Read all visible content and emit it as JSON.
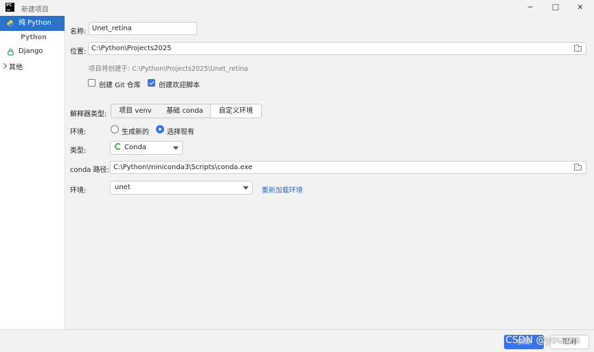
{
  "window": {
    "title": "新建项目",
    "logo_text_top": "PC",
    "minimize": "─",
    "maximize": "☐",
    "close": "✕"
  },
  "sidebar": {
    "items": [
      {
        "label": "纯 Python",
        "icon": "python-icon",
        "selected": true
      },
      {
        "label": "Django",
        "icon": "django-lock-icon",
        "selected": false
      },
      {
        "label": "其他",
        "icon": "chevron-right-icon",
        "selected": false
      }
    ],
    "group_label": "Python"
  },
  "form": {
    "name_label": "名称:",
    "name_value": "Unet_retina",
    "location_label": "位置:",
    "location_value": "C:\\Python\\Projects2025",
    "location_hint": "项目将创建于: C:\\Python\\Projects2025\\Unet_retina",
    "git_label": "创建 Git 仓库",
    "git_checked": false,
    "welcome_label": "创建欢迎脚本",
    "welcome_checked": true,
    "interpreter_type_label": "解释器类型:",
    "interpreter_tabs": [
      {
        "label": "项目 venv",
        "active": false
      },
      {
        "label": "基础 conda",
        "active": false
      },
      {
        "label": "自定义环境",
        "active": true
      }
    ],
    "environment_label": "环境:",
    "env_options": [
      {
        "label": "生成新的",
        "checked": false
      },
      {
        "label": "选择现有",
        "checked": true
      }
    ],
    "type_label": "类型:",
    "type_value": "Conda",
    "conda_path_label": "conda 路径:",
    "conda_path_value": "C:\\Python\\miniconda3\\Scripts\\conda.exe",
    "env2_label": "环境:",
    "env2_value": "unet",
    "reload_link": "重新加载环境"
  },
  "footer": {
    "create_button": "创建",
    "cancel_button": "取消"
  },
  "watermark": "CSDN @youans",
  "colors": {
    "accent": "#3574f0",
    "selected_sidebar": "#2b73c8",
    "link": "#2b6bc9"
  }
}
